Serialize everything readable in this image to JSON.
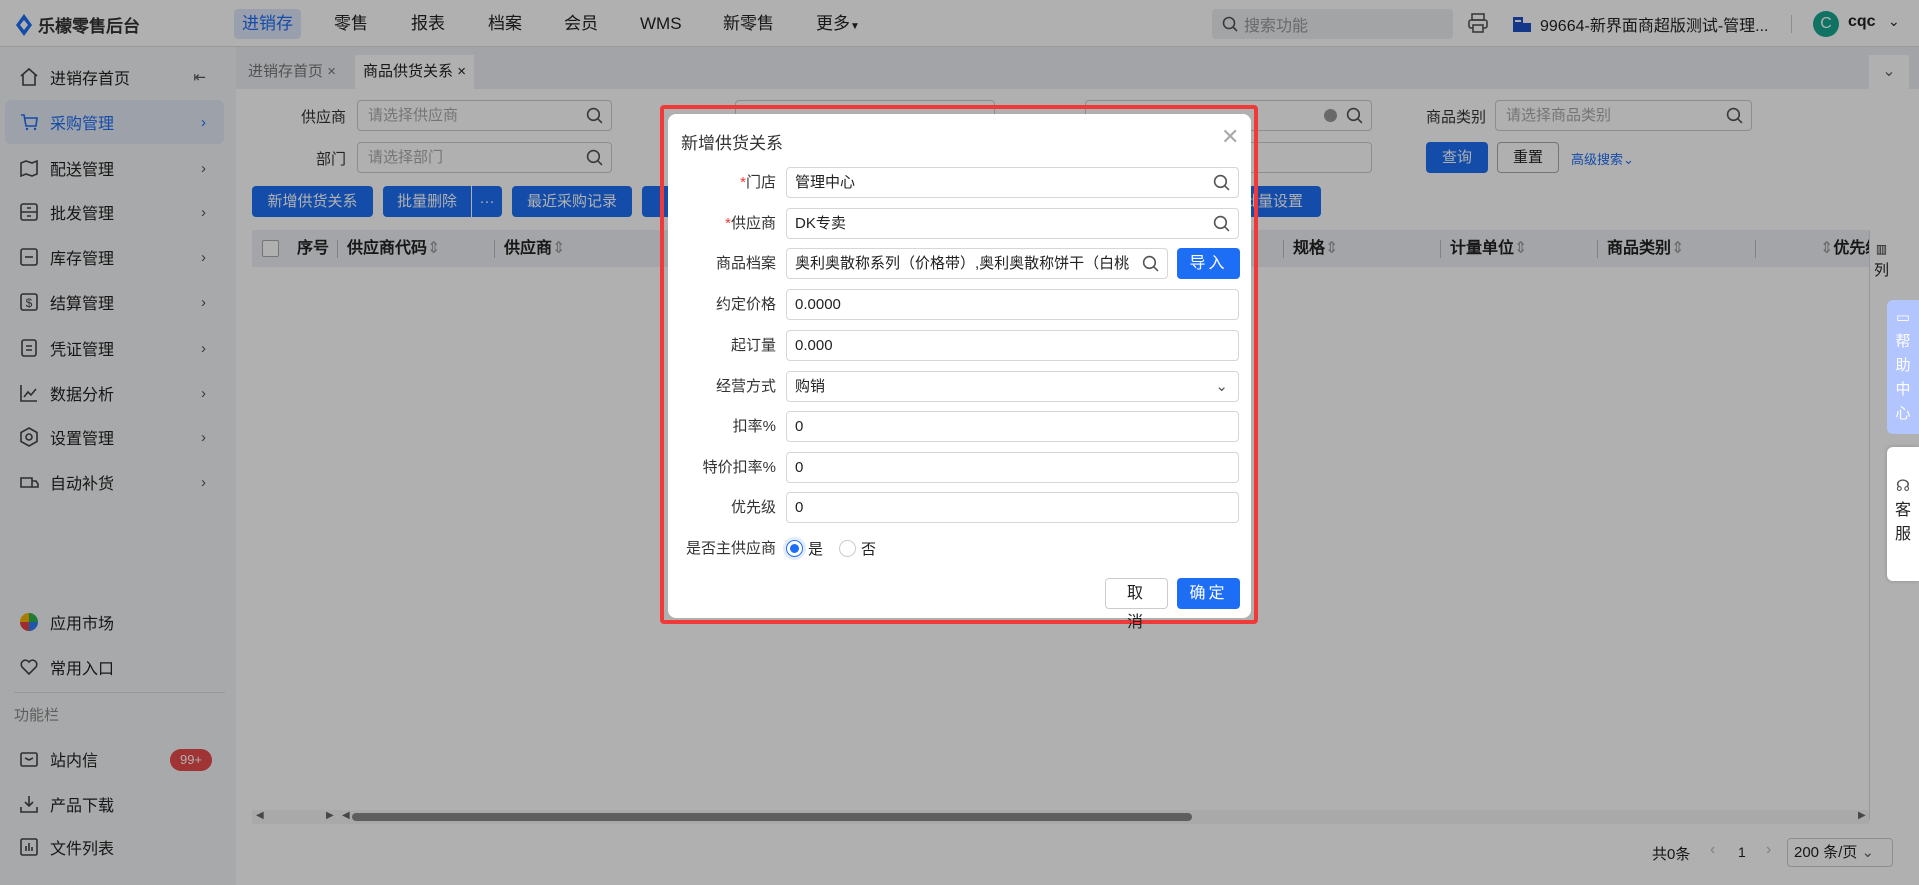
{
  "topbar": {
    "logo": "乐檬零售后台",
    "nav": [
      "进销存",
      "零售",
      "报表",
      "档案",
      "会员",
      "WMS",
      "新零售",
      "更多"
    ],
    "search_placeholder": "搜索功能",
    "store": "99664-新界面商超版测试-管理...",
    "user": "cqc",
    "avatar_letter": "C"
  },
  "sidebar": {
    "items": [
      "进销存首页",
      "采购管理",
      "配送管理",
      "批发管理",
      "库存管理",
      "结算管理",
      "凭证管理",
      "数据分析",
      "设置管理",
      "自动补货"
    ],
    "bottom": [
      "应用市场",
      "常用入口"
    ],
    "section": "功能栏",
    "tools": [
      "站内信",
      "产品下载",
      "文件列表"
    ],
    "badge": "99+"
  },
  "tabs": [
    "进销存首页",
    "商品供货关系"
  ],
  "filters": {
    "supplier_label": "供应商",
    "supplier_ph": "请选择供应商",
    "dept_label": "部门",
    "dept_ph": "请选择部门",
    "category_label": "商品类别",
    "category_ph": "请选择商品类别",
    "query": "查询",
    "reset": "重置",
    "advanced": "高级搜索"
  },
  "toolbar": {
    "add": "新增供货关系",
    "batch_delete": "批量删除",
    "more": "···",
    "recent": "最近采购记录",
    "batch_set": "批量设置"
  },
  "table": {
    "headers": [
      "序号",
      "供应商代码",
      "供应商",
      "规格",
      "计量单位",
      "商品类别",
      "优先级"
    ],
    "columns_btn": "列"
  },
  "pagination": {
    "total": "共0条",
    "page": "1",
    "page_size": "200 条/页"
  },
  "side_panels": {
    "help": "帮助中心",
    "service": "客服"
  },
  "dialog": {
    "title": "新增供货关系",
    "fields": [
      {
        "label": "门店",
        "required": true,
        "value": "管理中心"
      },
      {
        "label": "供应商",
        "required": true,
        "value": "DK专卖"
      },
      {
        "label": "商品档案",
        "value": "奥利奥散称系列（价格带）,奥利奥散称饼干（白桃"
      },
      {
        "label": "约定价格",
        "value": "0.0000"
      },
      {
        "label": "起订量",
        "value": "0.000"
      },
      {
        "label": "经营方式",
        "value": "购销"
      },
      {
        "label": "扣率%",
        "value": "0"
      },
      {
        "label": "特价扣率%",
        "value": "0"
      },
      {
        "label": "优先级",
        "value": "0"
      }
    ],
    "import": "导入",
    "main_supplier_label": "是否主供应商",
    "yes": "是",
    "no": "否",
    "cancel": "取消",
    "ok": "确定",
    "required_mark": "*"
  }
}
